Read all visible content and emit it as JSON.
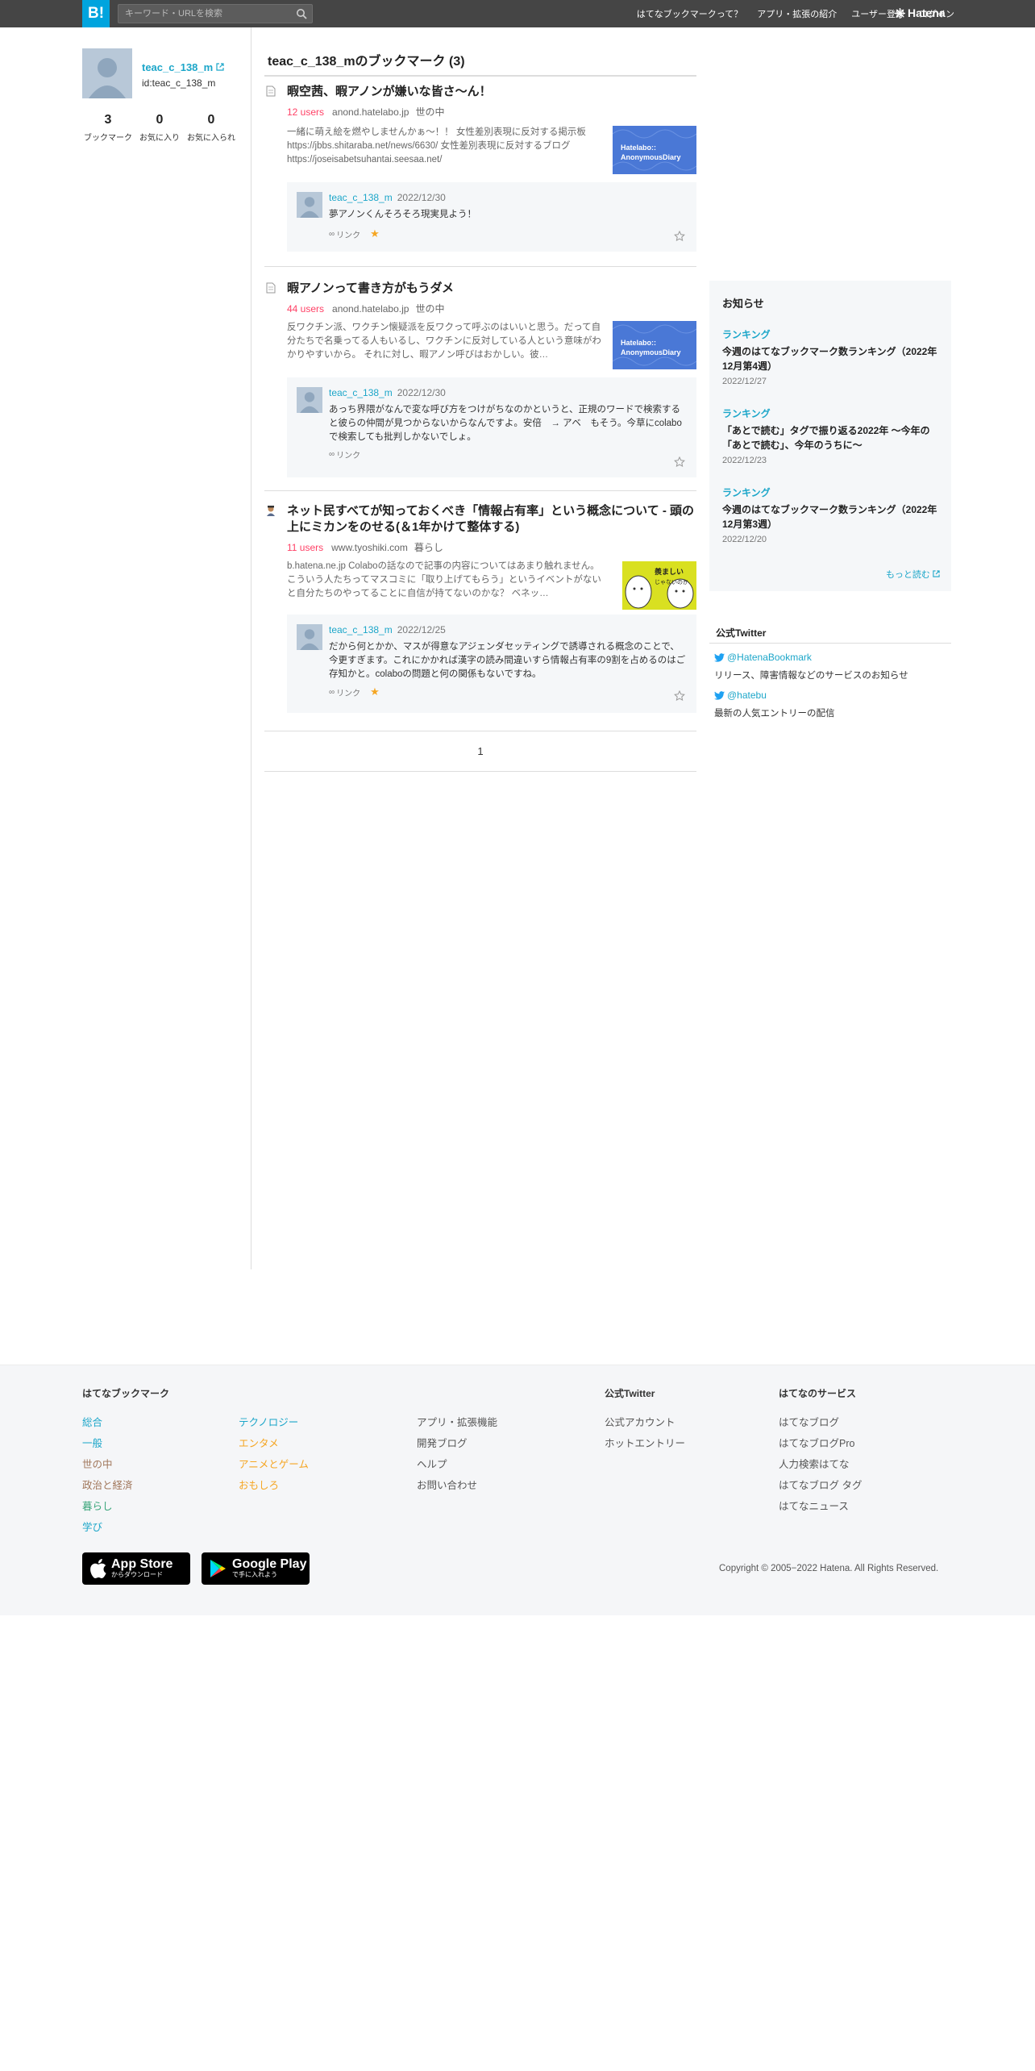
{
  "header": {
    "logo": "B!",
    "search_placeholder": "キーワード・URLを検索",
    "nav": [
      "はてなブックマークって？",
      "アプリ・拡張の紹介",
      "ユーザー登録",
      "ログイン"
    ],
    "brand": "Hatena",
    "bar_color": "#454545",
    "logo_color": "#00a4de"
  },
  "profile": {
    "name": "teac_c_138_m",
    "id": "id:teac_c_138_m",
    "stats": [
      {
        "value": "3",
        "label": "ブックマーク"
      },
      {
        "value": "0",
        "label": "お気に入り"
      },
      {
        "value": "0",
        "label": "お気に入られ"
      }
    ]
  },
  "main": {
    "title": "teac_c_138_mのブックマーク (3)",
    "entries": [
      {
        "title": "暇空茜、暇アノンが嫌いな皆さ～ん！",
        "users": "12 users",
        "domain": "anond.hatelabo.jp",
        "category": "世の中",
        "desc": "一緒に萌え絵を燃やしませんかぁ～！！ 女性差別表現に反対する掲示板 https://jbbs.shitaraba.net/news/6630/ 女性差別表現に反対するブログ https://joseisabetsuhantai.seesaa.net/",
        "thumb_text": [
          "Hatelabo::",
          "AnonymousDiary"
        ],
        "comment": {
          "user": "teac_c_138_m",
          "date": "2022/12/30",
          "text": "夢アノンくんそろそろ現実見よう！",
          "link": "リンク",
          "starred": true
        }
      },
      {
        "title": "暇アノンって書き方がもうダメ",
        "users": "44 users",
        "domain": "anond.hatelabo.jp",
        "category": "世の中",
        "desc": "反ワクチン派、ワクチン懐疑派を反ワクって呼ぶのはいいと思う。だって自分たちで名乗ってる人もいるし、ワクチンに反対している人という意味がわかりやすいから。 それに対し、暇アノン呼びはおかしい。彼…",
        "thumb_text": [
          "Hatelabo::",
          "AnonymousDiary"
        ],
        "comment": {
          "user": "teac_c_138_m",
          "date": "2022/12/30",
          "text": "あっち界隈がなんで変な呼び方をつけがちなのかというと、正規のワードで検索すると彼らの仲間が見つからないからなんですよ。安倍　→ アベ　もそう。今草にcolaboで検索しても批判しかないでしょ。",
          "link": "リンク",
          "starred": false
        }
      },
      {
        "title": "ネット民すべてが知っておくべき「情報占有率」という概念について - 頭の上にミカンをのせる(＆1年かけて整体する)",
        "users": "11 users",
        "domain": "www.tyoshiki.com",
        "category": "暮らし",
        "desc": "b.hatena.ne.jp Colaboの話なので記事の内容についてはあまり触れません。 こういう人たちってマスコミに「取り上げてもらう」というイベントがないと自分たちのやってることに自信が持てないのかな？ ベネッ…",
        "thumb_text": [
          "羨ましい",
          "じゃないのか"
        ],
        "comment": {
          "user": "teac_c_138_m",
          "date": "2022/12/25",
          "text": "だから何とかか、マスが得意なアジェンダセッティングで誘導される概念のことで、今更すぎます。これにかかれば漢字の読み間違いすら情報占有率の9割を占めるのはご存知かと。colaboの問題と何の関係もないですね。",
          "link": "リンク",
          "starred": true
        }
      }
    ],
    "page": "1"
  },
  "news": {
    "heading": "お知らせ",
    "items": [
      {
        "category": "ランキング",
        "title": "今週のはてなブックマーク数ランキング（2022年12月第4週）",
        "date": "2022/12/27"
      },
      {
        "category": "ランキング",
        "title": "「あとで読む」タグで振り返る2022年 〜今年の「あとで読む」、今年のうちに〜",
        "date": "2022/12/23"
      },
      {
        "category": "ランキング",
        "title": "今週のはてなブックマーク数ランキング（2022年12月第3週）",
        "date": "2022/12/20"
      }
    ],
    "more": "もっと読む"
  },
  "twitter": {
    "heading": "公式Twitter",
    "accounts": [
      {
        "handle": "@HatenaBookmark",
        "desc": "リリース、障害情報などのサービスのお知らせ"
      },
      {
        "handle": "@hatebu",
        "desc": "最新の人気エントリーの配信"
      }
    ]
  },
  "footer": {
    "col1_heading": "はてなブックマーク",
    "col1": [
      "総合",
      "一般",
      "世の中",
      "政治と経済",
      "暮らし",
      "学び"
    ],
    "col2": [
      "テクノロジー",
      "エンタメ",
      "アニメとゲーム",
      "おもしろ"
    ],
    "col3": [
      "アプリ・拡張機能",
      "開発ブログ",
      "ヘルプ",
      "お問い合わせ"
    ],
    "col4_heading": "公式Twitter",
    "col4": [
      "公式アカウント",
      "ホットエントリー"
    ],
    "col5_heading": "はてなのサービス",
    "col5": [
      "はてなブログ",
      "はてなブログPro",
      "人力検索はてな",
      "はてなブログ タグ",
      "はてなニュース"
    ],
    "appstore": {
      "big": "App Store",
      "small": "からダウンロード"
    },
    "googleplay": {
      "big": "Google Play",
      "small": "で手に入れよう"
    },
    "copyright": "Copyright © 2005−2022 Hatena. All Rights Reserved."
  }
}
